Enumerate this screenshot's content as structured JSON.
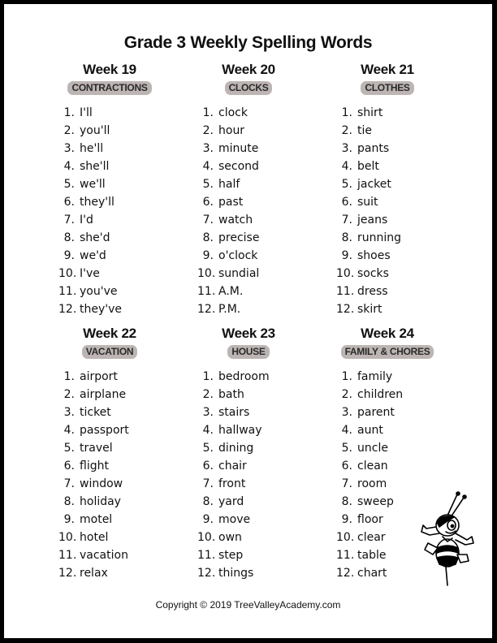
{
  "title": "Grade 3 Weekly Spelling Words",
  "weeks": [
    {
      "heading": "Week 19",
      "category": "CONTRACTIONS",
      "words": [
        {
          "num": "1.",
          "word": "I'll"
        },
        {
          "num": "2.",
          "word": "you'll"
        },
        {
          "num": "3.",
          "word": "he'll"
        },
        {
          "num": "4.",
          "word": "she'll"
        },
        {
          "num": "5.",
          "word": "we'll"
        },
        {
          "num": "6.",
          "word": "they'll"
        },
        {
          "num": "7.",
          "word": "I'd"
        },
        {
          "num": "8.",
          "word": "she'd"
        },
        {
          "num": "9.",
          "word": "we'd"
        },
        {
          "num": "10.",
          "word": "I've"
        },
        {
          "num": "11.",
          "word": "you've"
        },
        {
          "num": "12.",
          "word": "they've"
        }
      ]
    },
    {
      "heading": "Week 20",
      "category": "CLOCKS",
      "words": [
        {
          "num": "1.",
          "word": "clock"
        },
        {
          "num": "2.",
          "word": "hour"
        },
        {
          "num": "3.",
          "word": "minute"
        },
        {
          "num": "4.",
          "word": "second"
        },
        {
          "num": "5.",
          "word": "half"
        },
        {
          "num": "6.",
          "word": "past"
        },
        {
          "num": "7.",
          "word": "watch"
        },
        {
          "num": "8.",
          "word": "precise"
        },
        {
          "num": "9.",
          "word": "o'clock"
        },
        {
          "num": "10.",
          "word": "sundial"
        },
        {
          "num": "11.",
          "word": "A.M."
        },
        {
          "num": "12.",
          "word": "P.M."
        }
      ]
    },
    {
      "heading": "Week 21",
      "category": "CLOTHES",
      "words": [
        {
          "num": "1.",
          "word": "shirt"
        },
        {
          "num": "2.",
          "word": "tie"
        },
        {
          "num": "3.",
          "word": "pants"
        },
        {
          "num": "4.",
          "word": "belt"
        },
        {
          "num": "5.",
          "word": "jacket"
        },
        {
          "num": "6.",
          "word": "suit"
        },
        {
          "num": "7.",
          "word": "jeans"
        },
        {
          "num": "8.",
          "word": "running"
        },
        {
          "num": "9.",
          "word": "shoes"
        },
        {
          "num": "10.",
          "word": "socks"
        },
        {
          "num": "11.",
          "word": "dress"
        },
        {
          "num": "12.",
          "word": "skirt"
        }
      ]
    },
    {
      "heading": "Week 22",
      "category": "VACATION",
      "words": [
        {
          "num": "1.",
          "word": "airport"
        },
        {
          "num": "2.",
          "word": "airplane"
        },
        {
          "num": "3.",
          "word": "ticket"
        },
        {
          "num": "4.",
          "word": "passport"
        },
        {
          "num": "5.",
          "word": "travel"
        },
        {
          "num": "6.",
          "word": "flight"
        },
        {
          "num": "7.",
          "word": "window"
        },
        {
          "num": "8.",
          "word": "holiday"
        },
        {
          "num": "9.",
          "word": "motel"
        },
        {
          "num": "10.",
          "word": "hotel"
        },
        {
          "num": "11.",
          "word": "vacation"
        },
        {
          "num": "12.",
          "word": "relax"
        }
      ]
    },
    {
      "heading": "Week 23",
      "category": "HOUSE",
      "words": [
        {
          "num": "1.",
          "word": "bedroom"
        },
        {
          "num": "2.",
          "word": "bath"
        },
        {
          "num": "3.",
          "word": "stairs"
        },
        {
          "num": "4.",
          "word": "hallway"
        },
        {
          "num": "5.",
          "word": "dining"
        },
        {
          "num": "6.",
          "word": "chair"
        },
        {
          "num": "7.",
          "word": "front"
        },
        {
          "num": "8.",
          "word": "yard"
        },
        {
          "num": "9.",
          "word": "move"
        },
        {
          "num": "10.",
          "word": "own"
        },
        {
          "num": "11.",
          "word": "step"
        },
        {
          "num": "12.",
          "word": "things"
        }
      ]
    },
    {
      "heading": "Week 24",
      "category": "FAMILY & CHORES",
      "words": [
        {
          "num": "1.",
          "word": "family"
        },
        {
          "num": "2.",
          "word": "children"
        },
        {
          "num": "3.",
          "word": "parent"
        },
        {
          "num": "4.",
          "word": "aunt"
        },
        {
          "num": "5.",
          "word": "uncle"
        },
        {
          "num": "6.",
          "word": "clean"
        },
        {
          "num": "7.",
          "word": "room"
        },
        {
          "num": "8.",
          "word": "sweep"
        },
        {
          "num": "9.",
          "word": "floor"
        },
        {
          "num": "10.",
          "word": "clear"
        },
        {
          "num": "11.",
          "word": "table"
        },
        {
          "num": "12.",
          "word": "chart"
        }
      ]
    }
  ],
  "footer": "Copyright © 2019 TreeValleyAcademy.com",
  "illustration": "bee-mascot-icon",
  "colors": {
    "frame": "#000000",
    "badge_bg": "#bdb5b3",
    "badge_text": "#2a2a2a",
    "text": "#111111"
  }
}
